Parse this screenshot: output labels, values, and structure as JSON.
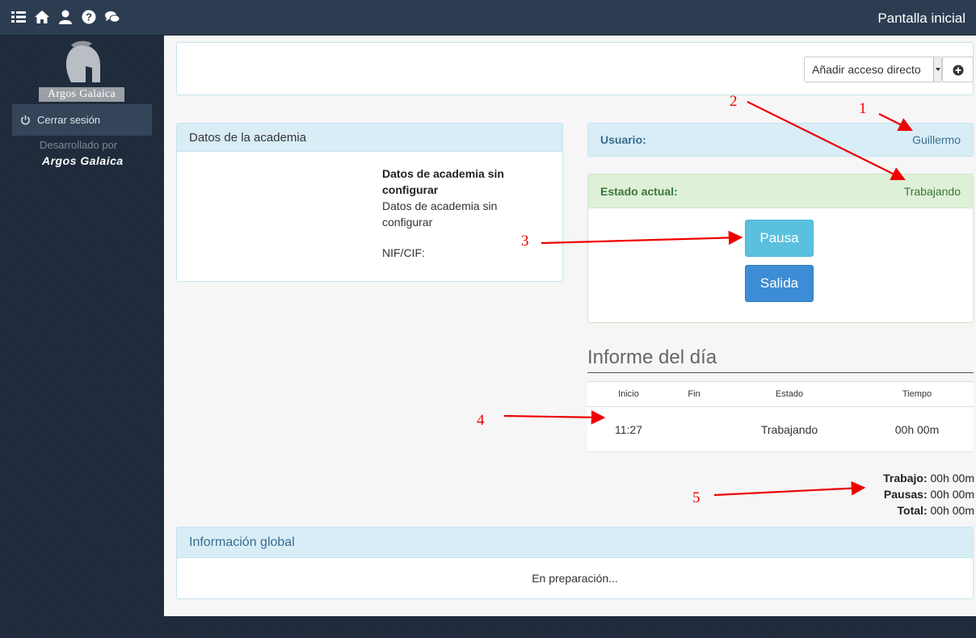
{
  "topbar": {
    "title": "Pantalla inicial",
    "icons": [
      "list-icon",
      "home-icon",
      "user-icon",
      "help-icon",
      "chat-icon"
    ]
  },
  "sidebar": {
    "logo_text": "Argos Galaica",
    "logout_label": "Cerrar sesión",
    "developed_by": "Desarrollado por",
    "developer": "Argos Galaica"
  },
  "shortcut": {
    "select_value": "Añadir acceso directo"
  },
  "academia": {
    "header": "Datos de la academia",
    "name": "Datos de academia sin configurar",
    "subtitle": "Datos de academia sin configurar",
    "nif": "NIF/CIF:"
  },
  "usuario": {
    "label": "Usuario:",
    "value": "Guillermo"
  },
  "estado": {
    "label": "Estado actual:",
    "value": "Trabajando",
    "pause_label": "Pausa",
    "exit_label": "Salida"
  },
  "report": {
    "title": "Informe del día",
    "columns": [
      "Inicio",
      "Fin",
      "Estado",
      "Tiempo"
    ],
    "rows": [
      [
        "11:27",
        "",
        "Trabajando",
        "00h 00m"
      ]
    ],
    "totals": {
      "trabajo_label": "Trabajo:",
      "trabajo": "00h 00m",
      "pausas_label": "Pausas:",
      "pausas": "00h 00m",
      "total_label": "Total:",
      "total": "00h 00m"
    }
  },
  "global": {
    "header": "Información global",
    "body": "En preparación..."
  },
  "annotations": [
    "1",
    "2",
    "3",
    "4",
    "5"
  ],
  "colors": {
    "annotation": "#e00000",
    "topbar": "#2c3d52",
    "info_header": "#d9edf7",
    "success_header": "#dff0d8",
    "btn_pausa": "#5bc0de",
    "btn_salida": "#3c8dd5"
  }
}
